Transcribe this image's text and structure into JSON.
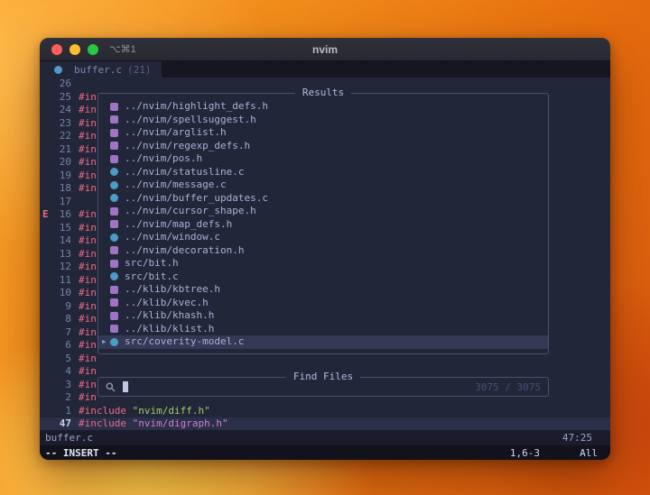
{
  "colors": {
    "background": "#222639",
    "include_red": "#ec6a88",
    "string_green": "#9ece6a",
    "string_magenta": "#d57ad1",
    "h_icon": "#a074c4",
    "c_icon": "#4e9ac9",
    "selection_blue": "#7aa2f7",
    "traffic_lights": [
      "#ff5f57",
      "#febc2e",
      "#28c840"
    ]
  },
  "icons": {
    "selection_caret": "▸"
  },
  "titlebar": {
    "shortcut": "⌥⌘1",
    "title": "nvim"
  },
  "tabline": {
    "label": "buffer.c",
    "count": "(21)"
  },
  "editor": {
    "lines": [
      {
        "n": "26",
        "c": ""
      },
      {
        "n": "25",
        "c": "#in"
      },
      {
        "n": "24",
        "c": "#in"
      },
      {
        "n": "23",
        "c": "#in"
      },
      {
        "n": "22",
        "c": "#in"
      },
      {
        "n": "21",
        "c": "#in"
      },
      {
        "n": "20",
        "c": "#in"
      },
      {
        "n": "19",
        "c": "#in"
      },
      {
        "n": "18",
        "c": "#in"
      },
      {
        "n": "17",
        "c": ""
      },
      {
        "n": "16",
        "c": "#in",
        "sign": "E"
      },
      {
        "n": "15",
        "c": "#in"
      },
      {
        "n": "14",
        "c": "#in"
      },
      {
        "n": "13",
        "c": "#in"
      },
      {
        "n": "12",
        "c": "#in"
      },
      {
        "n": "11",
        "c": "#in"
      },
      {
        "n": "10",
        "c": "#in"
      },
      {
        "n": "9",
        "c": "#in"
      },
      {
        "n": "8",
        "c": "#in"
      },
      {
        "n": "7",
        "c": "#in"
      },
      {
        "n": "6",
        "c": "#in"
      },
      {
        "n": "5",
        "c": "#in"
      },
      {
        "n": "4",
        "c": "#in"
      },
      {
        "n": "3",
        "c": "#in"
      },
      {
        "n": "2",
        "c": "#in"
      },
      {
        "n": "1",
        "inc": "#include",
        "str": "\"nvim/diff.h\"",
        "strc": "green"
      },
      {
        "n": "47",
        "inc": "#include",
        "str": "\"nvim/digraph.h\"",
        "strc": "pink",
        "cur": true
      }
    ]
  },
  "results": {
    "title": "Results",
    "items": [
      {
        "icon": "h",
        "name": "../nvim/highlight_defs.h"
      },
      {
        "icon": "h",
        "name": "../nvim/spellsuggest.h"
      },
      {
        "icon": "h",
        "name": "../nvim/arglist.h"
      },
      {
        "icon": "h",
        "name": "../nvim/regexp_defs.h"
      },
      {
        "icon": "h",
        "name": "../nvim/pos.h"
      },
      {
        "icon": "c",
        "name": "../nvim/statusline.c"
      },
      {
        "icon": "c",
        "name": "../nvim/message.c"
      },
      {
        "icon": "c",
        "name": "../nvim/buffer_updates.c"
      },
      {
        "icon": "h",
        "name": "../nvim/cursor_shape.h"
      },
      {
        "icon": "h",
        "name": "../nvim/map_defs.h"
      },
      {
        "icon": "c",
        "name": "../nvim/window.c"
      },
      {
        "icon": "h",
        "name": "../nvim/decoration.h"
      },
      {
        "icon": "h",
        "name": "src/bit.h"
      },
      {
        "icon": "c",
        "name": "src/bit.c"
      },
      {
        "icon": "h",
        "name": "../klib/kbtree.h"
      },
      {
        "icon": "h",
        "name": "../klib/kvec.h"
      },
      {
        "icon": "h",
        "name": "../klib/khash.h"
      },
      {
        "icon": "h",
        "name": "../klib/klist.h"
      },
      {
        "icon": "c",
        "name": "src/coverity-model.c",
        "sel": true
      }
    ]
  },
  "prompt": {
    "title": "Find Files",
    "counter": "3075 / 3075"
  },
  "statusline": {
    "file": "buffer.c",
    "position": "47:25"
  },
  "cmdline": {
    "mode": "-- INSERT --",
    "ruler": "1,6-3",
    "scroll": "All"
  }
}
